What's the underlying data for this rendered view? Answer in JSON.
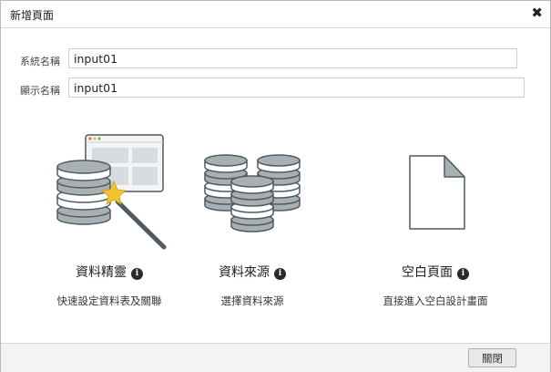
{
  "dialog": {
    "title": "新增頁面",
    "close_glyph": "✖"
  },
  "form": {
    "system_name_label": "系統名稱",
    "system_name_value": "input01",
    "display_name_label": "顯示名稱",
    "display_name_value": "input01"
  },
  "options": [
    {
      "title": "資料精靈",
      "description": "快速設定資料表及關聯",
      "icon": "database-wizard-icon"
    },
    {
      "title": "資料來源",
      "description": "選擇資料來源",
      "icon": "databases-icon"
    },
    {
      "title": "空白頁面",
      "description": "直接進入空白設計畫面",
      "icon": "blank-page-icon"
    }
  ],
  "info_glyph": "i",
  "footer": {
    "close_label": "關閉"
  },
  "colors": {
    "db_fill": "#a8b0b4",
    "db_stroke": "#505a60",
    "star": "#f3c431",
    "wand": "#505a60"
  }
}
